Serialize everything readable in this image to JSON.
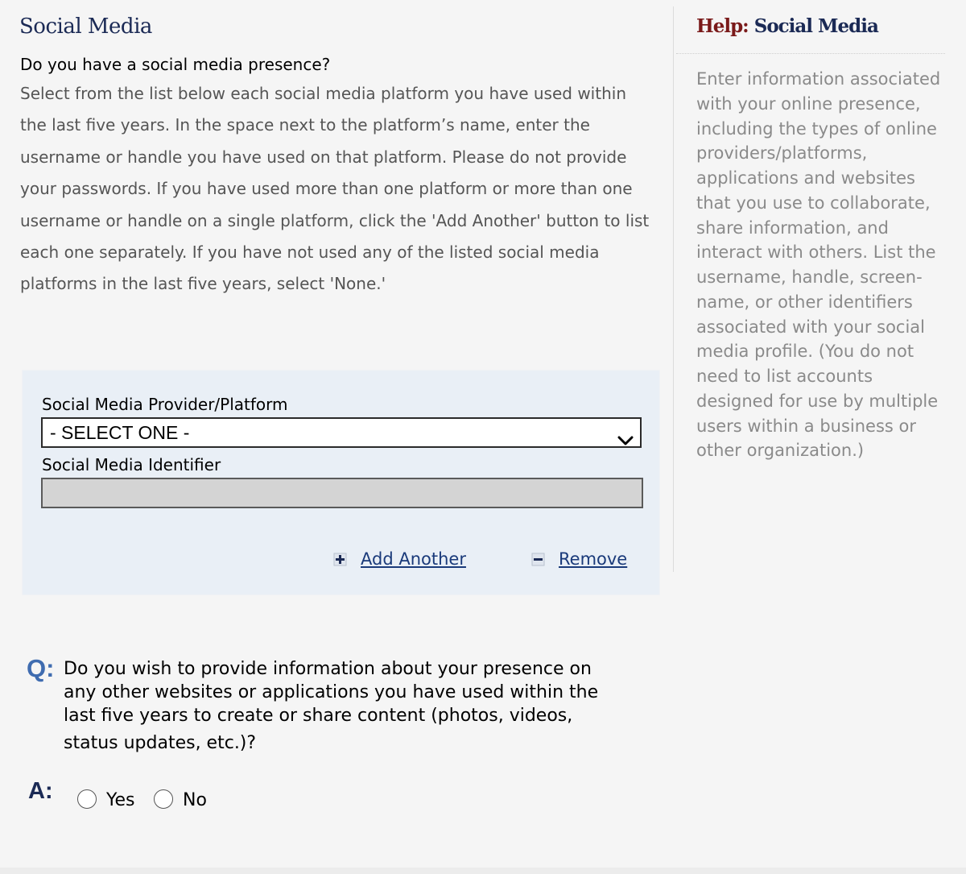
{
  "main": {
    "section_title": "Social Media",
    "question_heading": "Do you have a social media presence?",
    "instructions": "Select from the list below each social media platform you have used within the last five years. In the space next to the platform’s name, enter the username or handle you have used on that platform. Please do not provide your passwords. If you have used more than one platform or more than one username or handle on a single platform, click the 'Add Another' button to list each one separately. If you have not used any of the listed social media platforms in the last five years, select 'None.'",
    "panel": {
      "platform_label": "Social Media Provider/Platform",
      "platform_selected": "- SELECT ONE -",
      "identifier_label": "Social Media Identifier",
      "identifier_value": "",
      "add_another_label": "Add Another",
      "remove_label": "Remove"
    },
    "question": {
      "q_label": "Q:",
      "text_lines": [
        "Do you wish to provide information about your presence on",
        "any other websites or applications you have used within the",
        "last five years to create or share content (photos, videos,",
        "status updates, etc.)?"
      ],
      "a_label": "A:",
      "options": [
        "Yes",
        "No"
      ]
    }
  },
  "help": {
    "title_prefix": "Help:",
    "title_subject": "Social Media",
    "text": "Enter information associated with your online presence, including the types of online providers/platforms, applications and websites that you use to collaborate, share information, and interact with others. List the username, handle, screen-name, or other identifiers associated with your social media profile. (You do not need to list accounts designed for use by multiple users within a business or other organization.)"
  },
  "colors": {
    "title_navy": "#1b2a55",
    "help_prefix_red": "#7a1a1a",
    "q_blue": "#3f6cb0",
    "panel_bg": "#e9eff6",
    "link": "#1a3a7a",
    "help_text_gray": "#8a8a8a"
  },
  "icons": {
    "add": "plus-square-icon",
    "remove": "minus-square-icon",
    "select": "chevron-down-icon"
  }
}
